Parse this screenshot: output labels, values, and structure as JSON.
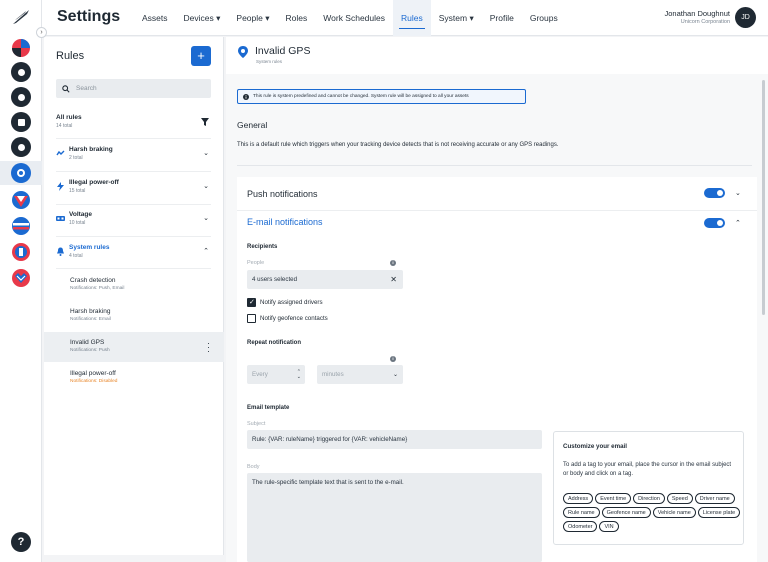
{
  "app": {
    "title": "Settings"
  },
  "nav": [
    {
      "label": "Assets",
      "caret": false,
      "active": false
    },
    {
      "label": "Devices",
      "caret": true,
      "active": false
    },
    {
      "label": "People",
      "caret": true,
      "active": false
    },
    {
      "label": "Roles",
      "caret": false,
      "active": false
    },
    {
      "label": "Work Schedules",
      "caret": false,
      "active": false
    },
    {
      "label": "Rules",
      "caret": false,
      "active": true
    },
    {
      "label": "System",
      "caret": true,
      "active": false
    },
    {
      "label": "Profile",
      "caret": false,
      "active": false
    },
    {
      "label": "Groups",
      "caret": false,
      "active": false
    }
  ],
  "user": {
    "name": "Jonathan Doughnut",
    "org": "Unicorn Corporation",
    "initials": "JD"
  },
  "rail": {
    "icons": [
      "app-logo-icon",
      "brand-red-icon",
      "dashboard-icon",
      "location-icon",
      "assets-icon",
      "tools-icon",
      "settings-icon",
      "brand-shield-icon",
      "brand-stripes-icon",
      "brand-badge-icon",
      "brand-heart-icon"
    ],
    "help": "?",
    "accent_colors": {
      "red": "#e8394a",
      "blue": "#1b6ad1",
      "dark": "#1f2933"
    }
  },
  "rules": {
    "heading": "Rules",
    "add_label": "+",
    "search_placeholder": "Search",
    "all": {
      "name": "All rules",
      "count": "14 total"
    },
    "groups": [
      {
        "name": "Harsh braking",
        "count": "2 total",
        "icon": "harsh-braking-icon"
      },
      {
        "name": "Illegal power-off",
        "count": "15 total",
        "icon": "power-off-icon"
      },
      {
        "name": "Voltage",
        "count": "10 total",
        "icon": "battery-icon"
      },
      {
        "name": "System rules",
        "count": "4 total",
        "icon": "bell-icon"
      }
    ],
    "system_items": [
      {
        "name": "Crash detection",
        "note": "Notifications: Push, Email"
      },
      {
        "name": "Harsh braking",
        "note": "Notifications: Email"
      },
      {
        "name": "Invalid GPS",
        "note": "Notifications: Push"
      },
      {
        "name": "Illegal power-off",
        "note": "Notifications: Disabled"
      }
    ]
  },
  "detail": {
    "title": "Invalid GPS",
    "subtitle": "System rules",
    "notice": "This rule is system predefined and cannot be changed. System rule will be assigned to all your assets",
    "section": "General",
    "description": "This is a default rule which triggers when your tracking device detects that is not receiving accurate or any GPS readings.",
    "push_label": "Push notifications",
    "email_label": "E-mail notifications",
    "recipients_label": "Recipients",
    "people_label": "People",
    "people_value": "4 users selected",
    "notify_drivers": "Notify assigned drivers",
    "notify_geofence": "Notify geofence contacts",
    "repeat_label": "Repeat notification",
    "every_placeholder": "Every",
    "unit_value": "minutes",
    "template_label": "Email template",
    "subject_label": "Subject",
    "subject_value": "Rule: {VAR: ruleName} triggered for {VAR: vehicleName}",
    "body_label": "Body",
    "body_value": "The rule-specific template text that is sent to the e-mail.",
    "customize_title": "Customize your email",
    "customize_desc": "To add a tag to your email, place the cursor in the email subject or body and click on a tag.",
    "tags": [
      "Address",
      "Event time",
      "Direction",
      "Speed",
      "Driver name",
      "Rule name",
      "Geofence name",
      "Vehicle name",
      "License plate",
      "Odometer",
      "VIN"
    ]
  }
}
